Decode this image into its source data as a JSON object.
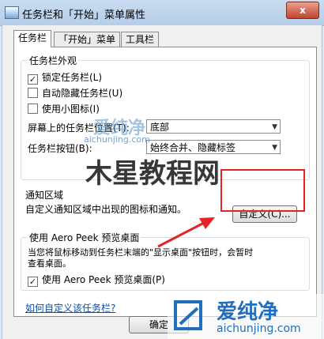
{
  "window": {
    "title": "任务栏和「开始」菜单属性",
    "close_label": "x"
  },
  "tabs": [
    {
      "label": "任务栏"
    },
    {
      "label": "「开始」菜单"
    },
    {
      "label": "工具栏"
    }
  ],
  "appearance": {
    "title": "任务栏外观",
    "lock": {
      "label": "锁定任务栏(L)",
      "checked": true
    },
    "autohide": {
      "label": "自动隐藏任务栏(U)",
      "checked": false
    },
    "small_icons": {
      "label": "使用小图标(I)",
      "checked": false
    },
    "location": {
      "label": "屏幕上的任务栏位置(T):",
      "value": "底部"
    },
    "buttons": {
      "label": "任务栏按钮(B):",
      "value": "始终合并、隐藏标签"
    }
  },
  "notification": {
    "title": "通知区域",
    "text": "自定义通知区域中出现的图标和通知。",
    "customize_button": "自定义(C)..."
  },
  "aero_peek": {
    "title": "使用 Aero Peek 预览桌面",
    "description_line1": "当您将鼠标移动到任务栏末端的\"显示桌面\"按钮时，会暂时",
    "description_line2": "查看桌面。",
    "checkbox": {
      "label": "使用 Aero Peek 预览桌面(P)",
      "checked": true
    }
  },
  "help_link": "如何自定义该任务栏?",
  "footer": {
    "ok_button": "确定"
  },
  "watermarks": {
    "small_brand": "爱纯净",
    "small_url": "aichunjing.com",
    "big_brand": "木星教程网",
    "corner_brand": "爱纯净",
    "corner_url": "aichunjing.com"
  },
  "colors": {
    "highlight": "#e52323",
    "link": "#0b4fa8"
  }
}
